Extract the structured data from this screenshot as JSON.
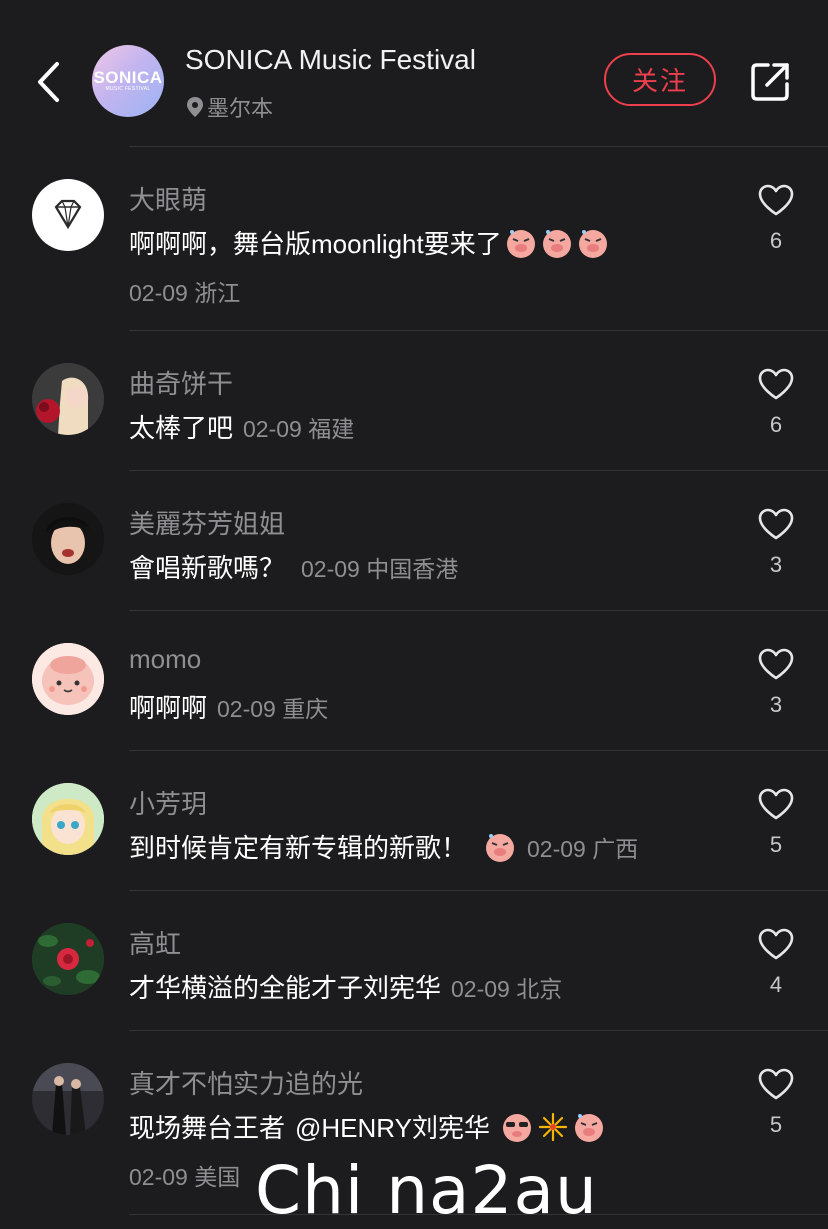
{
  "header": {
    "title": "SONICA Music Festival",
    "location": "墨尔本",
    "follow_label": "关注",
    "logo_main": "SONICA",
    "logo_sub": "MUSIC FESTIVAL",
    "icons": {
      "back": "back-chevron-icon",
      "location": "location-pin-icon",
      "share": "share-icon"
    }
  },
  "comments": [
    {
      "user": "大眼萌",
      "text": "啊啊啊，舞台版moonlight要来了",
      "emojis": 3,
      "meta": "02-09 浙江",
      "likes": "6"
    },
    {
      "user": "曲奇饼干",
      "text": "太棒了吧",
      "meta": "02-09 福建",
      "likes": "6"
    },
    {
      "user": "美麗芬芳姐姐",
      "text": "會唱新歌嗎？",
      "meta": "02-09 中国香港",
      "likes": "3"
    },
    {
      "user": "momo",
      "text": "啊啊啊",
      "meta": "02-09 重庆",
      "likes": "3"
    },
    {
      "user": "小芳玥",
      "text": "到时候肯定有新专辑的新歌！",
      "emojis": 1,
      "meta": "02-09 广西",
      "likes": "5"
    },
    {
      "user": "高虹",
      "text": "才华横溢的全能才子刘宪华",
      "meta": "02-09 北京",
      "likes": "4"
    },
    {
      "user": "真才不怕实力追的光",
      "text": "现场舞台王者",
      "mention": "@HENRY刘宪华",
      "emojis": 3,
      "meta": "02-09 美国",
      "likes": "5"
    }
  ],
  "watermark": "Chi na2au",
  "colors": {
    "background": "#1c1c1e",
    "accent": "#ee3f4d",
    "secondary_text": "#8e8e93"
  }
}
